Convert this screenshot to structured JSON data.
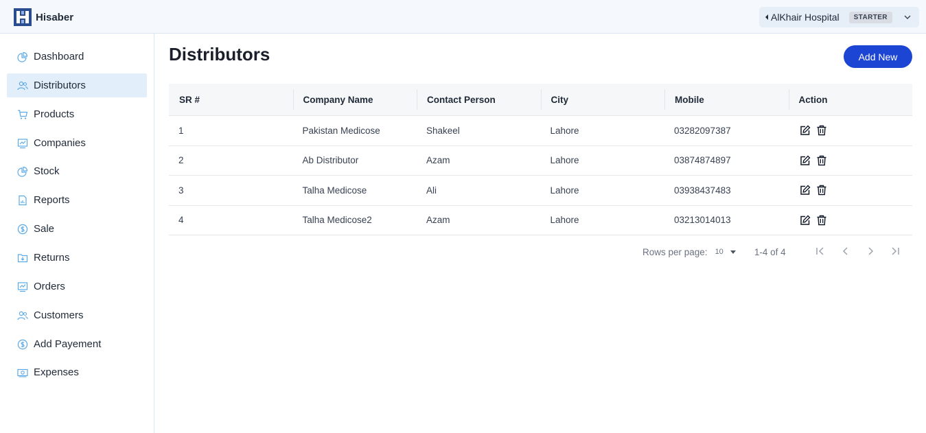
{
  "app": {
    "brand": "Hisaber"
  },
  "org": {
    "name": "AlKhair Hospital",
    "plan": "STARTER"
  },
  "sidebar": {
    "items": [
      {
        "label": "Dashboard",
        "icon": "pie-chart-icon"
      },
      {
        "label": "Distributors",
        "icon": "users-icon",
        "active": true
      },
      {
        "label": "Products",
        "icon": "cart-icon"
      },
      {
        "label": "Companies",
        "icon": "chart-board-icon"
      },
      {
        "label": "Stock",
        "icon": "pie-chart-icon"
      },
      {
        "label": "Reports",
        "icon": "document-icon"
      },
      {
        "label": "Sale",
        "icon": "dollar-icon"
      },
      {
        "label": "Returns",
        "icon": "folder-download-icon"
      },
      {
        "label": "Orders",
        "icon": "chart-board-icon"
      },
      {
        "label": "Customers",
        "icon": "users-icon"
      },
      {
        "label": "Add Payement",
        "icon": "dollar-icon"
      },
      {
        "label": "Expenses",
        "icon": "cash-icon"
      }
    ]
  },
  "page": {
    "title": "Distributors",
    "add_button": "Add New"
  },
  "table": {
    "headers": [
      "SR #",
      "Company Name",
      "Contact Person",
      "City",
      "Mobile",
      "Action"
    ],
    "rows": [
      [
        "1",
        "Pakistan Medicose",
        "Shakeel",
        "Lahore",
        "03282097387"
      ],
      [
        "2",
        "Ab Distributor",
        "Azam",
        "Lahore",
        "03874874897"
      ],
      [
        "3",
        "Talha Medicose",
        "Ali",
        "Lahore",
        "03938437483"
      ],
      [
        "4",
        "Talha Medicose2",
        "Azam",
        "Lahore",
        "03213014013"
      ]
    ]
  },
  "pagination": {
    "rows_label": "Rows per page:",
    "rows_value": "10",
    "range": "1-4 of 4"
  },
  "colors": {
    "primary": "#1d45d4",
    "sidebar_active": "#e3eefb",
    "icon_blue": "#5aa9e6"
  }
}
